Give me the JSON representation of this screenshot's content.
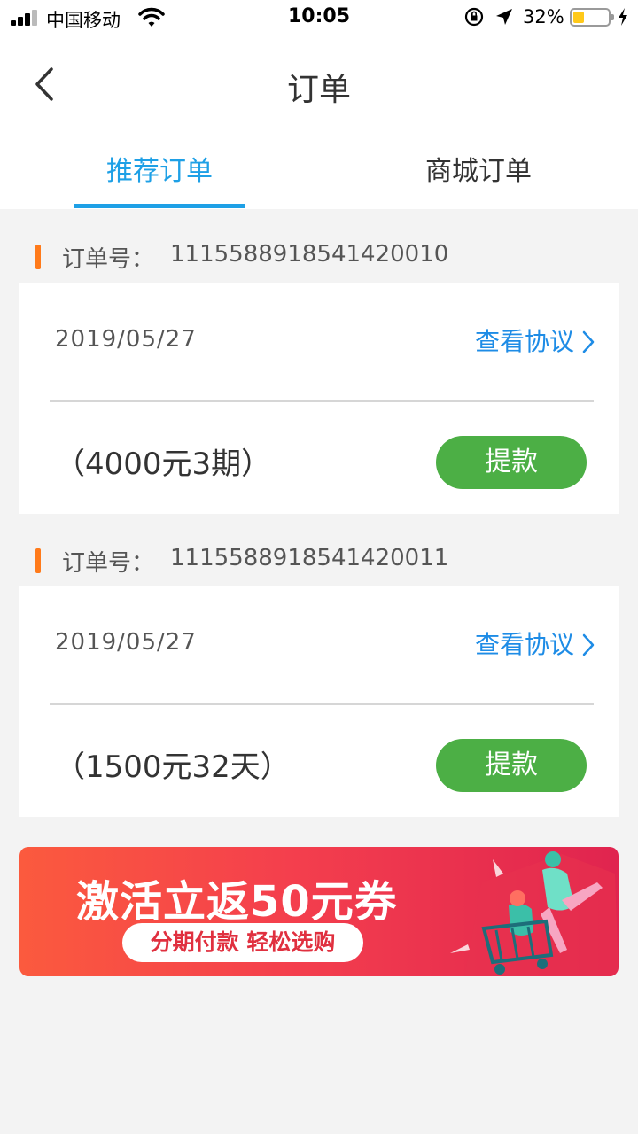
{
  "status_bar": {
    "carrier": "中国移动",
    "time": "10:05",
    "battery_percent": "32%",
    "battery_level": 0.32,
    "icons": [
      "signal-icon",
      "wifi-icon",
      "rotation-lock-icon",
      "location-arrow-icon",
      "battery-icon",
      "charging-icon"
    ]
  },
  "nav": {
    "title": "订单",
    "back_icon": "chevron-left-icon"
  },
  "tabs": [
    {
      "label": "推荐订单",
      "active": true
    },
    {
      "label": "商城订单",
      "active": false
    }
  ],
  "orders": [
    {
      "order_label": "订单号：",
      "order_number": "1115588918541420010",
      "date": "2019/05/27",
      "view_label": "查看协议",
      "amount": "（4000元3期）",
      "action_label": "提款"
    },
    {
      "order_label": "订单号：",
      "order_number": "1115588918541420011",
      "date": "2019/05/27",
      "view_label": "查看协议",
      "amount": "（1500元32天）",
      "action_label": "提款"
    }
  ],
  "banner": {
    "headline": "激活立返50元券",
    "subline": "分期付款 轻松选购"
  },
  "colors": {
    "accent_blue": "#1ea0e6",
    "link_blue": "#1e8ce6",
    "order_marker": "#ff7a1a",
    "button_green": "#4caf45",
    "banner_red": "#f43f4d"
  }
}
